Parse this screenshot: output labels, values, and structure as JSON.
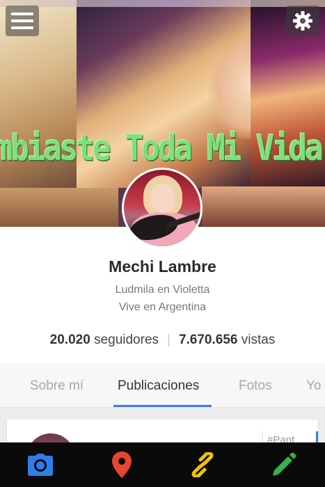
{
  "cover": {
    "overlay_text": "mbiaste Toda Mi Vida Mechi"
  },
  "header": {
    "menu_icon": "hamburger-menu-icon",
    "settings_icon": "gear-icon"
  },
  "profile": {
    "name": "Mechi Lambre",
    "bio_line1": "Ludmila en Violetta",
    "bio_line2": "Vive en Argentina",
    "followers_count": "20.020",
    "followers_label": "seguidores",
    "views_count": "7.670.656",
    "views_label": "vistas",
    "separator": "|"
  },
  "tabs": [
    {
      "label": "Sobre mí",
      "active": false
    },
    {
      "label": "Publicaciones",
      "active": true
    },
    {
      "label": "Fotos",
      "active": false
    },
    {
      "label": "Yo",
      "active": false
    }
  ],
  "feed": {
    "card_tag": "#Pant"
  },
  "bottom_bar": {
    "items": [
      {
        "icon": "camera-icon",
        "color": "#2f7de8"
      },
      {
        "icon": "map-pin-icon",
        "color": "#e8452f"
      },
      {
        "icon": "link-icon",
        "color": "#f2c200"
      },
      {
        "icon": "pencil-icon",
        "color": "#36b24a"
      }
    ]
  },
  "colors": {
    "accent": "#3d7de0",
    "cover_text": "#7de07a"
  }
}
